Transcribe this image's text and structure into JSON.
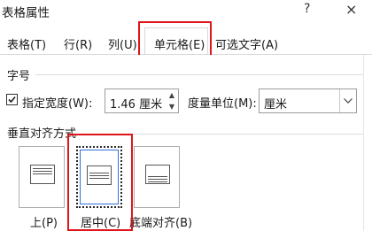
{
  "window": {
    "title": "表格属性",
    "help_label": "?",
    "close_label": "×"
  },
  "tabs": [
    {
      "label": "表格(T)"
    },
    {
      "label": "行(R)"
    },
    {
      "label": "列(U)"
    },
    {
      "label": "单元格(E)",
      "active": true
    },
    {
      "label": "可选文字(A)"
    }
  ],
  "size_section": {
    "label": "字号",
    "preferred_width_checkbox": {
      "label": "指定宽度(W):",
      "checked": true
    },
    "width_value": "1.46 厘米",
    "measure_label": "度量单位(M):",
    "measure_value": "厘米"
  },
  "valign_section": {
    "label": "垂直对齐方式",
    "options": [
      {
        "label": "上(P)",
        "selected": false
      },
      {
        "label": "居中(C)",
        "selected": true
      },
      {
        "label": "底端对齐(B)",
        "selected": false
      }
    ]
  },
  "annotation_color": "#e0141b"
}
